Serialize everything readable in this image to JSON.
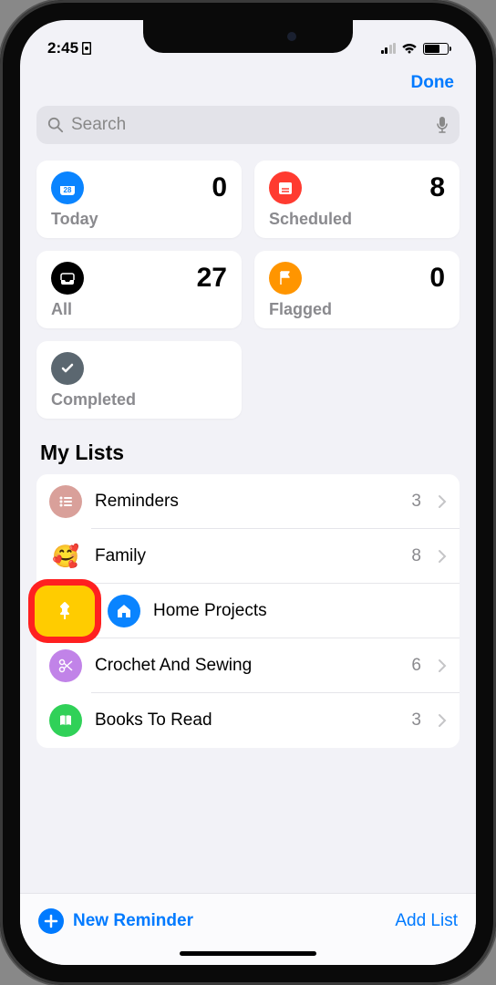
{
  "status": {
    "time": "2:45"
  },
  "nav": {
    "done": "Done"
  },
  "search": {
    "placeholder": "Search"
  },
  "cards": {
    "today": {
      "label": "Today",
      "count": "0"
    },
    "scheduled": {
      "label": "Scheduled",
      "count": "8"
    },
    "all": {
      "label": "All",
      "count": "27"
    },
    "flagged": {
      "label": "Flagged",
      "count": "0"
    },
    "completed": {
      "label": "Completed",
      "count": ""
    }
  },
  "section": {
    "title": "My Lists"
  },
  "lists": {
    "reminders": {
      "name": "Reminders",
      "count": "3"
    },
    "family": {
      "name": "Family",
      "count": "8"
    },
    "home": {
      "name": "Home Projects",
      "count": ""
    },
    "crochet": {
      "name": "Crochet And Sewing",
      "count": "6"
    },
    "books": {
      "name": "Books To Read",
      "count": "3"
    }
  },
  "bottom": {
    "new_reminder": "New Reminder",
    "add_list": "Add List"
  },
  "icons": {
    "family_emoji": "🥰"
  }
}
